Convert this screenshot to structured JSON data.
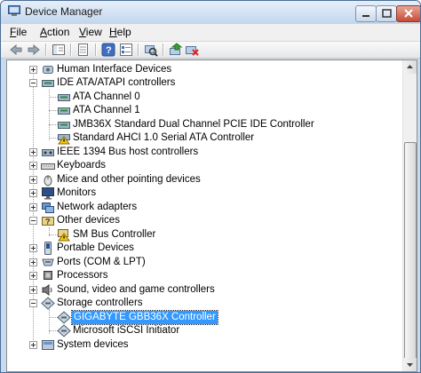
{
  "window": {
    "title": "Device Manager"
  },
  "menu": [
    {
      "key": "F",
      "rest": "ile"
    },
    {
      "key": "A",
      "rest": "ction"
    },
    {
      "key": "V",
      "rest": "iew"
    },
    {
      "key": "H",
      "rest": "elp"
    }
  ],
  "tree": [
    {
      "label": "Human Interface Devices",
      "icon": "hid-icon",
      "expander": "plus"
    },
    {
      "label": "IDE ATA/ATAPI controllers",
      "icon": "ide-controller-icon",
      "expander": "minus"
    },
    {
      "label": "ATA Channel 0",
      "icon": "ata-channel-icon"
    },
    {
      "label": "ATA Channel 1",
      "icon": "ata-channel-icon"
    },
    {
      "label": "JMB36X Standard Dual Channel PCIE IDE Controller",
      "icon": "ide-controller-icon"
    },
    {
      "label": "Standard AHCI 1.0 Serial ATA Controller",
      "icon": "warning-controller-icon"
    },
    {
      "label": "IEEE 1394 Bus host controllers",
      "icon": "ieee1394-icon",
      "expander": "plus"
    },
    {
      "label": "Keyboards",
      "icon": "keyboard-icon",
      "expander": "plus"
    },
    {
      "label": "Mice and other pointing devices",
      "icon": "mouse-icon",
      "expander": "plus"
    },
    {
      "label": "Monitors",
      "icon": "monitor-icon",
      "expander": "plus"
    },
    {
      "label": "Network adapters",
      "icon": "network-adapter-icon",
      "expander": "plus"
    },
    {
      "label": "Other devices",
      "icon": "other-devices-icon",
      "expander": "minus"
    },
    {
      "label": "SM Bus Controller",
      "icon": "warning-device-icon"
    },
    {
      "label": "Portable Devices",
      "icon": "portable-device-icon",
      "expander": "plus"
    },
    {
      "label": "Ports (COM & LPT)",
      "icon": "port-icon",
      "expander": "plus"
    },
    {
      "label": "Processors",
      "icon": "processor-icon",
      "expander": "plus"
    },
    {
      "label": "Sound, video and game controllers",
      "icon": "sound-icon",
      "expander": "plus"
    },
    {
      "label": "Storage controllers",
      "icon": "storage-controller-icon",
      "expander": "minus"
    },
    {
      "label": "GIGABYTE GBB36X Controller",
      "icon": "storage-device-icon",
      "selected": true
    },
    {
      "label": "Microsoft iSCSI Initiator",
      "icon": "storage-device-icon"
    },
    {
      "label": "System devices",
      "icon": "system-devices-icon",
      "expander": "plus"
    }
  ],
  "colors": {
    "selection": "#3399ff",
    "title_bar": "#c8daf0"
  }
}
